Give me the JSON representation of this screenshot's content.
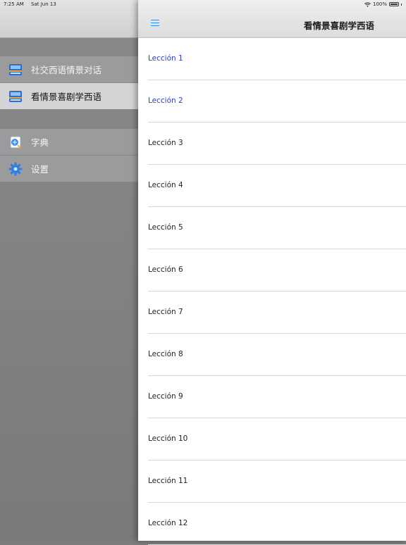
{
  "status_bar": {
    "time": "7:25 AM",
    "date": "Sat Jun 13",
    "battery": "100%"
  },
  "sidebar": {
    "groups": [
      {
        "items": [
          {
            "label": "社交西语情景对话",
            "icon": "book-icon",
            "selected": false
          },
          {
            "label": "看情景喜剧学西语",
            "icon": "book-icon",
            "selected": true
          }
        ]
      },
      {
        "items": [
          {
            "label": "字典",
            "icon": "dictionary-icon",
            "selected": false
          },
          {
            "label": "设置",
            "icon": "gear-icon",
            "selected": false
          }
        ]
      }
    ]
  },
  "main": {
    "title": "看情景喜剧学西语",
    "menu_icon": "hamburger-icon",
    "lessons": [
      {
        "label": "Lección 1",
        "visited": true
      },
      {
        "label": "Lección 2",
        "visited": true
      },
      {
        "label": "Lección 3",
        "visited": false
      },
      {
        "label": "Lección 4",
        "visited": false
      },
      {
        "label": "Lección 5",
        "visited": false
      },
      {
        "label": "Lección 6",
        "visited": false
      },
      {
        "label": "Lección 7",
        "visited": false
      },
      {
        "label": "Lección 8",
        "visited": false
      },
      {
        "label": "Lección 9",
        "visited": false
      },
      {
        "label": "Lección 10",
        "visited": false
      },
      {
        "label": "Lección 11",
        "visited": false
      },
      {
        "label": "Lección 12",
        "visited": false
      }
    ]
  },
  "colors": {
    "link_visited": "#2b3fc7",
    "accent": "#3a8de0"
  }
}
